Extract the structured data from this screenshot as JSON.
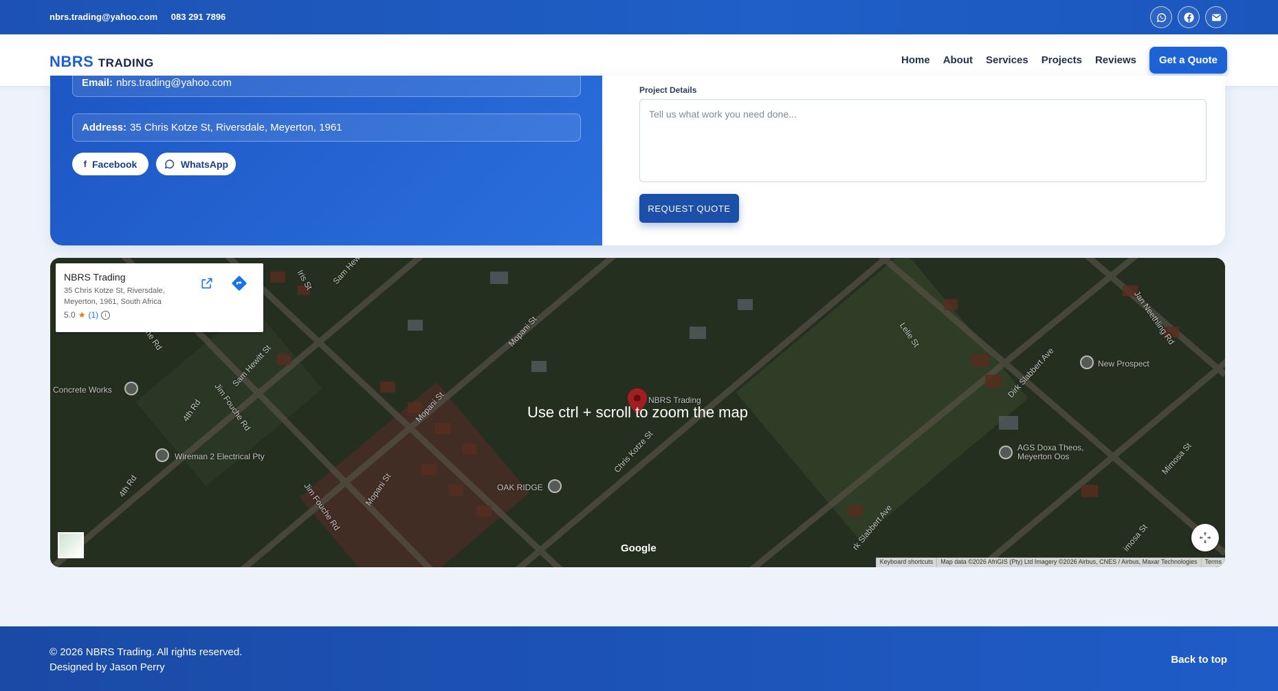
{
  "topbar": {
    "email": "nbrs.trading@yahoo.com",
    "phone": "083 291 7896",
    "icons": [
      "whatsapp-icon",
      "facebook-icon",
      "mail-icon"
    ]
  },
  "nav": {
    "logo_primary": "NBRS",
    "logo_secondary": "TRADING",
    "links": [
      "Home",
      "About",
      "Services",
      "Projects",
      "Reviews"
    ],
    "cta": "Get a Quote"
  },
  "contact": {
    "email_label": "Email:",
    "email_value": "nbrs.trading@yahoo.com",
    "address_label": "Address:",
    "address_value": "35 Chris Kotze St, Riversdale, Meyerton, 1961",
    "facebook_label": "Facebook",
    "whatsapp_label": "WhatsApp"
  },
  "form": {
    "project_details_label": "Project Details",
    "project_details_placeholder": "Tell us what work you need done...",
    "submit_label": "REQUEST QUOTE"
  },
  "map": {
    "place_name": "NBRS Trading",
    "place_address": "35 Chris Kotze St, Riversdale, Meyerton, 1961, South Africa",
    "rating": "5.0",
    "rating_count": "(1)",
    "hint": "Use ctrl + scroll to zoom the map",
    "pin_label": "NBRS Trading",
    "poi_labels": [
      "Concrete Works",
      "Wireman 2 Electrical Pty",
      "OAK RIDGE",
      "New Prospect",
      "AGS Doxa Theos, Meyerton Oos"
    ],
    "street_labels": [
      "Iris St",
      "Sam Hew",
      "Mopani St",
      "Sam Hewitt St",
      "Jim Fouche Rd",
      "4th Rd",
      "Mopani St",
      "Chris Kotze St",
      "Lelie St",
      "Jan Neethling Rd",
      "Dirk Slabbert Ave",
      "Mimosa St",
      "che Rd",
      "Jim Fouche Rd",
      "Mopani St",
      "4th Rd",
      "rk Slabbert Ave",
      "imosa St"
    ],
    "brand": "Google",
    "attribution": [
      "Keyboard shortcuts",
      "Map data ©2026 AfriGIS (Pty) Ltd Imagery ©2026 Airbus, CNES / Airbus, Maxar Technologies",
      "Terms"
    ]
  },
  "footer": {
    "copyright": "© 2026 NBRS Trading. All rights reserved.",
    "designed_by": "Designed by Jason Perry",
    "back_to_top": "Back to top"
  }
}
